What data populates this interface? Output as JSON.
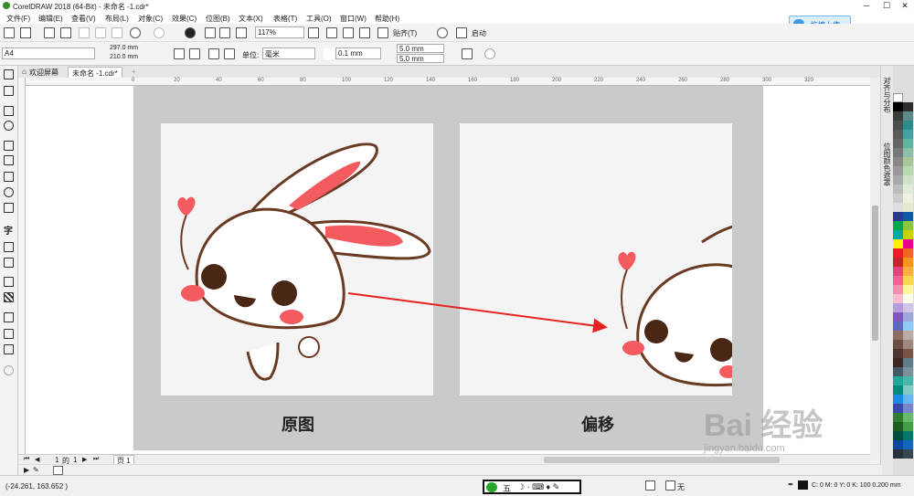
{
  "app": {
    "title": "CorelDRAW 2018 (64-Bit) - 未命名 -1.cdr*",
    "window_buttons": [
      "─",
      "☐",
      "✕"
    ],
    "upload_label": "拖拽上传"
  },
  "menu": [
    "文件(F)",
    "编辑(E)",
    "查看(V)",
    "布局(L)",
    "对象(C)",
    "效果(C)",
    "位图(B)",
    "文本(X)",
    "表格(T)",
    "工具(O)",
    "窗口(W)",
    "帮助(H)"
  ],
  "toolbar": {
    "zoom": "117%",
    "snap_label": "贴齐(T)",
    "launch_label": "启动"
  },
  "property_bar": {
    "page_size": "A4",
    "width": "297.0 mm",
    "height": "210.0 mm",
    "unit_label": "单位:",
    "unit_value": "毫米",
    "nudge": "0.1 mm",
    "dup_x": "5.0 mm",
    "dup_y": "5.0 mm"
  },
  "tabs": [
    {
      "label": "欢迎屏幕"
    },
    {
      "label": "未命名 -1.cdr*"
    }
  ],
  "ruler_labels": [
    "0",
    "20",
    "40",
    "60",
    "80",
    "100",
    "120",
    "140",
    "160",
    "180",
    "200",
    "220",
    "240",
    "260",
    "280",
    "300",
    "320"
  ],
  "document": {
    "left_caption": "原图",
    "right_caption": "偏移"
  },
  "dockers": [
    "对齐与分布",
    "位图颜色遮罩"
  ],
  "pager": {
    "current": "1",
    "of": "的",
    "total": "1",
    "page_tab": "页 1"
  },
  "status": {
    "coords": "(-24.261, 163.652 )",
    "ime_label": "五",
    "fill_label": "无",
    "color_info": "C: 0 M: 0 Y: 0 K: 100  0.200 mm"
  },
  "watermark": {
    "brand": "Bai 经验",
    "url": "jingyan.baidu.com"
  },
  "colors": {
    "page_bg": "#c9cbca",
    "rabbit_outline": "#6b3a22",
    "ear_pink": "#f35b5f",
    "arrow": "#e52320",
    "palette": [
      "#ffffff",
      "#000000",
      "#1e1e1e",
      "#333333",
      "#4d4d4d",
      "#666666",
      "#808080",
      "#999999",
      "#b3b3b3",
      "#cccccc",
      "#e6e6e6",
      "#2b3990",
      "#1a75bb",
      "#00a651",
      "#8cc63f",
      "#fff200",
      "#f7941d",
      "#ed1c24",
      "#ec008c",
      "#92278f",
      "#662d91",
      "#0072bc",
      "#00aeef",
      "#00a99d",
      "#39b54a",
      "#d7df23",
      "#fbb040",
      "#f15a29",
      "#c1272d",
      "#9e1f63"
    ]
  }
}
